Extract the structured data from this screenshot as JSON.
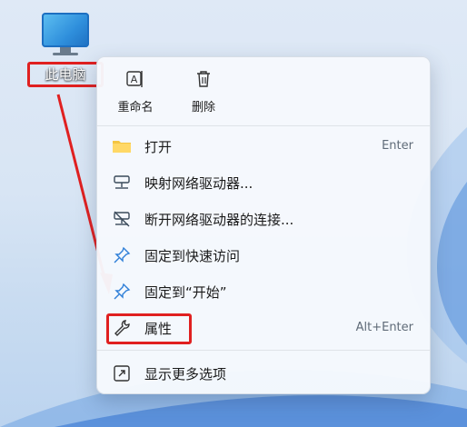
{
  "desktop": {
    "icon_label": "此电脑",
    "icon": "computer-icon"
  },
  "menu": {
    "quick_actions": [
      {
        "label": "重命名",
        "icon": "rename-icon"
      },
      {
        "label": "删除",
        "icon": "trash-icon"
      }
    ],
    "items": [
      {
        "label": "打开",
        "shortcut": "Enter",
        "icon": "folder-icon"
      },
      {
        "label": "映射网络驱动器...",
        "shortcut": "",
        "icon": "network-drive-icon"
      },
      {
        "label": "断开网络驱动器的连接...",
        "shortcut": "",
        "icon": "disconnect-drive-icon"
      },
      {
        "label": "固定到快速访问",
        "shortcut": "",
        "icon": "pin-icon"
      },
      {
        "label": "固定到“开始”",
        "shortcut": "",
        "icon": "pin-icon"
      },
      {
        "label": "属性",
        "shortcut": "Alt+Enter",
        "icon": "wrench-icon"
      },
      {
        "label": "显示更多选项",
        "shortcut": "",
        "icon": "more-options-icon"
      }
    ]
  },
  "colors": {
    "highlight": "#e02020",
    "accent": "#2f8fdc"
  }
}
